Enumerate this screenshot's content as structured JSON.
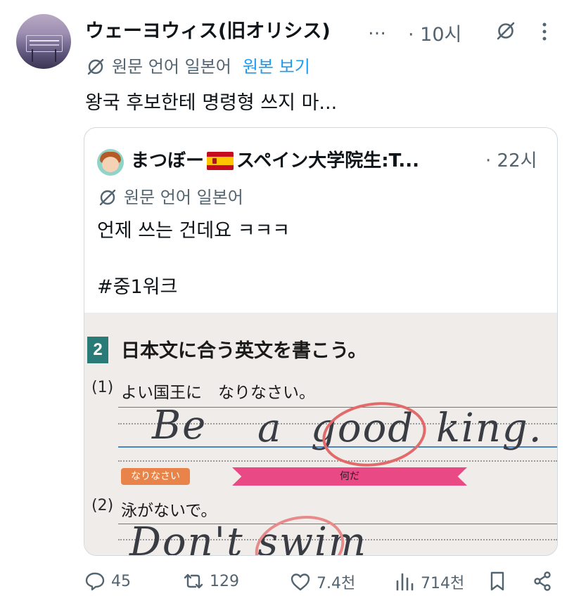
{
  "tweet": {
    "author_name": "ウェーヨウィス(旧オリシス)",
    "ellipsis": "…",
    "time": "· 10시",
    "translation_note": "원문 언어 일본어",
    "show_original": "원본 보기",
    "text": "왕국 후보한테 명령형 쓰지 마..."
  },
  "quote": {
    "author_prefix": "まつぼー",
    "author_suffix": "スペイン大学院生:T...",
    "time": "· 22시",
    "translation_note": "원문 언어 일본어",
    "text_line1": "언제 쓰는 건데요 ㅋㅋㅋ",
    "text_line2": "#중1워크"
  },
  "worksheet": {
    "number": "2",
    "title": "日本文に合う英文を書こう。",
    "q1_label": "(1)",
    "q1_text": "よい国王に　なりなさい。",
    "q1_answer_a": "Be",
    "q1_answer_b": "a",
    "q1_answer_c": "good",
    "q1_answer_d": "king.",
    "badge_label": "なりなさい",
    "ribbon_label": "何だ",
    "q2_label": "(2)",
    "q2_text": "泳がないで。",
    "q2_answer": "Don't  swim"
  },
  "actions": {
    "replies": "45",
    "reposts": "129",
    "likes": "7.4천",
    "views": "714천"
  },
  "colors": {
    "link_blue": "#1d9bf0",
    "muted_gray": "#536471",
    "text": "#0f1419"
  }
}
